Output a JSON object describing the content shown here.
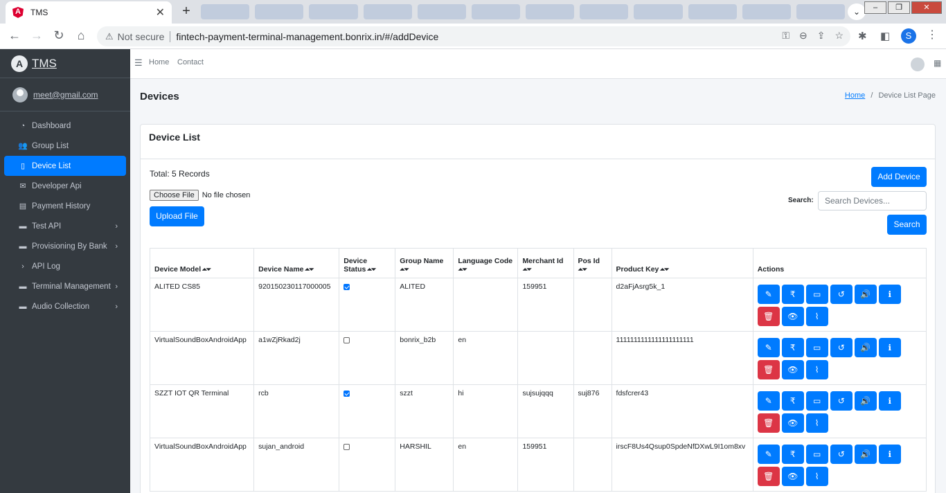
{
  "browser": {
    "tab_title": "TMS",
    "tab_close": "✕",
    "new_tab": "+",
    "security_label": "Not secure",
    "url": "fintech-payment-terminal-management.bonrix.in/#/addDevice",
    "profile_initial": "S"
  },
  "sidebar": {
    "brand": "TMS",
    "brand_logo": "A",
    "user_email": "meet@gmail.com",
    "items": [
      {
        "label": "Dashboard",
        "icon": "dashboard-icon",
        "glyph": "◔",
        "has_arrow": false
      },
      {
        "label": "Group List",
        "icon": "users-icon",
        "glyph": "👥",
        "has_arrow": false
      },
      {
        "label": "Device List",
        "icon": "mobile-icon",
        "glyph": "▯",
        "has_arrow": false,
        "active": true
      },
      {
        "label": "Developer Api",
        "icon": "envelope-open-icon",
        "glyph": "✉",
        "has_arrow": false
      },
      {
        "label": "Payment History",
        "icon": "list-icon",
        "glyph": "▤",
        "has_arrow": false
      },
      {
        "label": "Test API",
        "icon": "folder-icon",
        "glyph": "▬",
        "has_arrow": true
      },
      {
        "label": "Provisioning By Bank",
        "icon": "folder-icon",
        "glyph": "▬",
        "has_arrow": true
      },
      {
        "label": "API Log",
        "icon": "chevron-right-icon",
        "glyph": "›",
        "has_arrow": false
      },
      {
        "label": "Terminal Management",
        "icon": "folder-icon",
        "glyph": "▬",
        "has_arrow": true
      },
      {
        "label": "Audio Collection",
        "icon": "folder-icon",
        "glyph": "▬",
        "has_arrow": true
      }
    ]
  },
  "topnav": {
    "home": "Home",
    "contact": "Contact"
  },
  "page": {
    "title": "Devices",
    "breadcrumb_home": "Home",
    "breadcrumb_sep": "/",
    "breadcrumb_current": "Device List Page"
  },
  "card": {
    "title": "Device List",
    "total": "Total: 5 Records",
    "choose_file": "Choose File",
    "no_file": "No file chosen",
    "upload_button": "Upload File",
    "add_button": "Add Device",
    "search_label": "Search:",
    "search_placeholder": "Search Devices...",
    "search_button": "Search"
  },
  "table": {
    "columns": [
      "Device Model",
      "Device Name",
      "Device Status",
      "Group Name",
      "Language Code",
      "Merchant Id",
      "Pos Id",
      "Product Key",
      "Actions"
    ],
    "rows": [
      {
        "model": "ALITED CS85",
        "name": "920150230117000005",
        "status": true,
        "group": "ALITED",
        "lang": "",
        "merchant": "159951",
        "pos": "",
        "key": "d2aFjAsrg5k_1"
      },
      {
        "model": "VirtualSoundBoxAndroidApp",
        "name": "a1wZjRkad2j",
        "status": false,
        "group": "bonrix_b2b",
        "lang": "en",
        "merchant": "",
        "pos": "",
        "key": "1111111111111111111111"
      },
      {
        "model": "SZZT IOT QR Terminal",
        "name": "rcb",
        "status": true,
        "group": "szzt",
        "lang": "hi",
        "merchant": "sujsujqqq",
        "pos": "suj876",
        "key": "fdsfcrer43"
      },
      {
        "model": "VirtualSoundBoxAndroidApp",
        "name": "sujan_android",
        "status": false,
        "group": "HARSHIL",
        "lang": "en",
        "merchant": "159951",
        "pos": "",
        "key": "irscF8Us4Qsup0SpdeNfDXwL9I1om8xv"
      }
    ],
    "action_buttons": [
      {
        "name": "edit-icon",
        "glyph": "✎",
        "danger": false
      },
      {
        "name": "rupee-icon",
        "glyph": "₹",
        "danger": false
      },
      {
        "name": "desktop-icon",
        "glyph": "▭",
        "danger": false
      },
      {
        "name": "history-icon",
        "glyph": "↺",
        "danger": false
      },
      {
        "name": "volume-icon",
        "glyph": "🔊",
        "danger": false
      },
      {
        "name": "info-icon",
        "glyph": "ℹ",
        "danger": false
      },
      {
        "name": "trash-icon",
        "glyph": "🗑",
        "danger": true
      },
      {
        "name": "eye-icon",
        "glyph": "👁",
        "danger": false
      },
      {
        "name": "rss-icon",
        "glyph": "⌇",
        "danger": false
      }
    ]
  }
}
